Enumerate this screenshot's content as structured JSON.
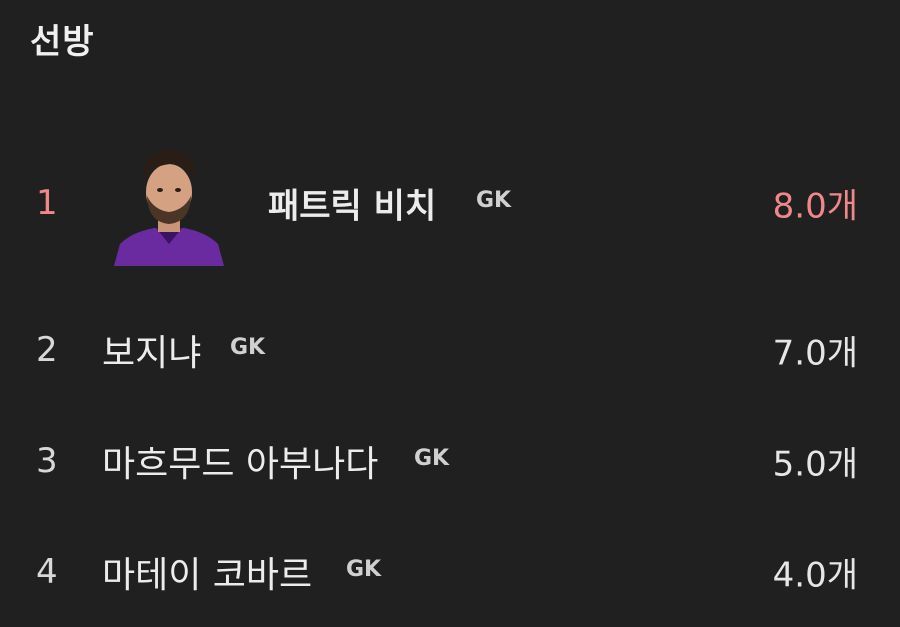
{
  "section": {
    "title": "선방"
  },
  "rows": [
    {
      "rank": "1",
      "name": "패트릭 비치",
      "position": "GK",
      "value": "8.0개"
    },
    {
      "rank": "2",
      "name": "보지냐",
      "position": "GK",
      "value": "7.0개"
    },
    {
      "rank": "3",
      "name": "마흐무드 아부나다",
      "position": "GK",
      "value": "5.0개"
    },
    {
      "rank": "4",
      "name": "마테이 코바르",
      "position": "GK",
      "value": "4.0개"
    }
  ],
  "colors": {
    "background": "#202020",
    "highlight": "#f0878a",
    "avatar_shirt": "#6a2ba0"
  },
  "icons": {
    "avatar": "player-photo"
  }
}
